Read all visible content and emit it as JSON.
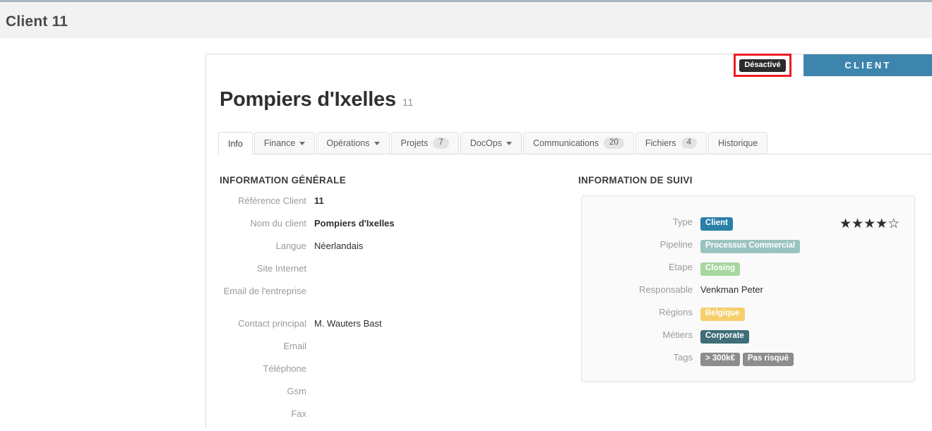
{
  "app_header": {
    "title": "Client 11"
  },
  "panel": {
    "status_badge": "Désactivé",
    "type_banner": "CLIENT",
    "record_title": "Pompiers d'Ixelles",
    "record_ref": "11"
  },
  "tabs": [
    {
      "label": "Info",
      "active": true,
      "caret": false,
      "count": null
    },
    {
      "label": "Finance",
      "active": false,
      "caret": true,
      "count": null
    },
    {
      "label": "Opérations",
      "active": false,
      "caret": true,
      "count": null
    },
    {
      "label": "Projets",
      "active": false,
      "caret": false,
      "count": "7"
    },
    {
      "label": "DocOps",
      "active": false,
      "caret": true,
      "count": null
    },
    {
      "label": "Communications",
      "active": false,
      "caret": false,
      "count": "20"
    },
    {
      "label": "Fichiers",
      "active": false,
      "caret": false,
      "count": "4"
    },
    {
      "label": "Historique",
      "active": false,
      "caret": false,
      "count": null
    }
  ],
  "general_info": {
    "section_title": "INFORMATION GÉNÉRALE",
    "fields": [
      {
        "label": "Référence Client",
        "value": "11",
        "bold": true
      },
      {
        "label": "Nom du client",
        "value": "Pompiers d'Ixelles",
        "bold": true
      },
      {
        "label": "Langue",
        "value": "Néerlandais",
        "bold": false
      },
      {
        "label": "Site Internet",
        "value": "",
        "bold": false
      },
      {
        "label": "Email de l'entreprise",
        "value": "",
        "bold": false
      },
      {
        "label": "",
        "value": "",
        "spacer": true
      },
      {
        "label": "Contact principal",
        "value": "M. Wauters Bast",
        "bold": false
      },
      {
        "label": "Email",
        "value": "",
        "bold": false
      },
      {
        "label": "Téléphone",
        "value": "",
        "bold": false
      },
      {
        "label": "Gsm",
        "value": "",
        "bold": false
      },
      {
        "label": "Fax",
        "value": "",
        "bold": false
      }
    ]
  },
  "tracking_info": {
    "section_title": "INFORMATION DE SUIVI",
    "rating": {
      "filled": 4,
      "total": 5,
      "filled_glyph": "★",
      "empty_glyph": "☆"
    },
    "fields": [
      {
        "label": "Type",
        "badges": [
          {
            "text": "Client",
            "color": "#2980a8"
          }
        ]
      },
      {
        "label": "Pipeline",
        "badges": [
          {
            "text": "Processus Commercial",
            "color": "#9bc3c1"
          }
        ]
      },
      {
        "label": "Etape",
        "badges": [
          {
            "text": "Closing",
            "color": "#a7d79f"
          }
        ]
      },
      {
        "label": "Responsable",
        "text": "Venkman Peter"
      },
      {
        "label": "Régions",
        "badges": [
          {
            "text": "Belgique",
            "color": "#f5cf6b"
          }
        ]
      },
      {
        "label": "Métiers",
        "badges": [
          {
            "text": "Corporate",
            "color": "#3f6e78"
          }
        ]
      },
      {
        "label": "Tags",
        "badges": [
          {
            "text": "> 300k€",
            "color": "#8d8d8d"
          },
          {
            "text": "Pas risqué",
            "color": "#8d8d8d"
          }
        ]
      }
    ]
  },
  "colors": {
    "header_bg": "#f2f2f2",
    "header_top_border": "#a8b6c4",
    "type_banner_bg": "#3d85ad",
    "status_badge_bg": "#2b2b2b",
    "highlight_box": "#ee1c25",
    "card_bg": "#fafafa"
  }
}
